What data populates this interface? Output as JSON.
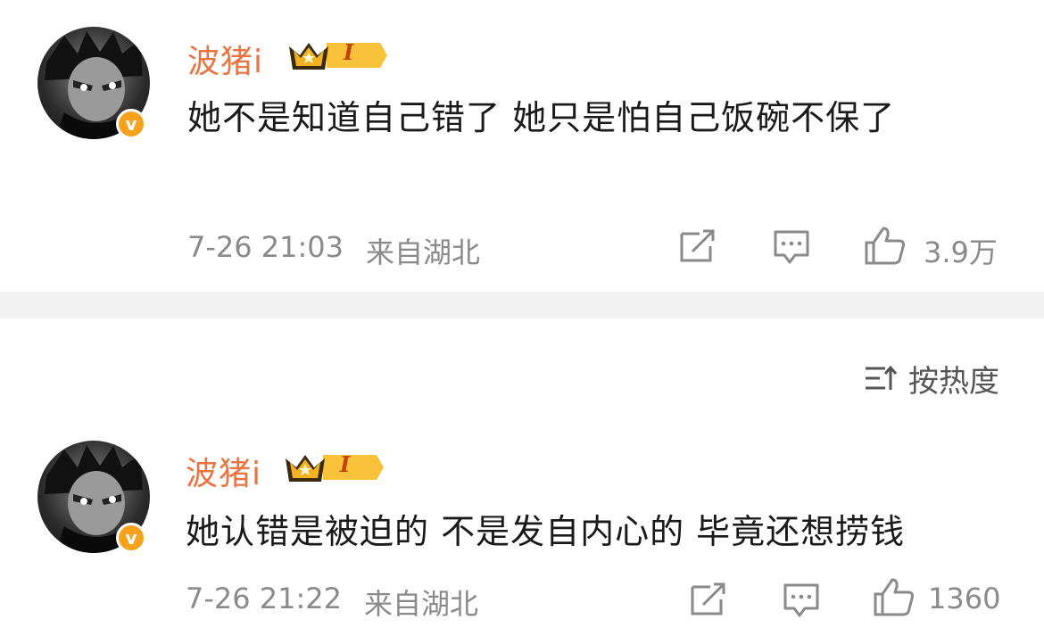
{
  "comments": [
    {
      "username": "波猪i",
      "level_badge": "I",
      "text": "她不是知道自己错了 她只是怕自己饭碗不保了",
      "timestamp": "7-26 21:03",
      "location": "来自湖北",
      "likes": "3.9万"
    },
    {
      "username": "波猪i",
      "level_badge": "I",
      "text": "她认错是被迫的 不是发自内心的 毕竟还想捞钱",
      "timestamp": "7-26 21:22",
      "location": "来自湖北",
      "likes": "1360"
    }
  ],
  "sort": {
    "label": "按热度",
    "icon": "sort-icon"
  },
  "icons": {
    "share": "share-icon",
    "comment": "comment-icon",
    "like": "thumbs-up-icon",
    "verified": "verified-v-icon",
    "crown": "crown-icon"
  },
  "colors": {
    "username": "#eb7340",
    "verified_badge": "#f7a21b",
    "meta_text": "#8a8a8a",
    "divider": "#f2f2f2"
  }
}
